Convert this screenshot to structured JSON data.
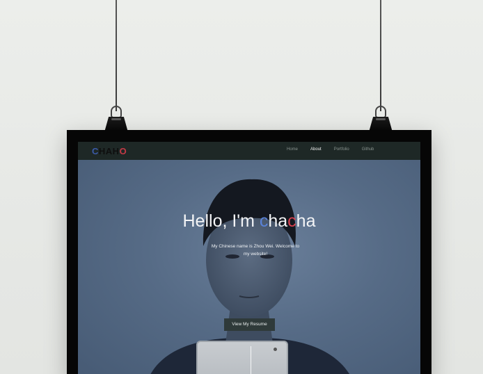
{
  "site": {
    "logo": {
      "part1": "C",
      "part2": "HAH",
      "part3": "O"
    },
    "nav": {
      "items": [
        {
          "label": "Home",
          "active": false
        },
        {
          "label": "About",
          "active": true
        },
        {
          "label": "Portfolio",
          "active": false
        },
        {
          "label": "Github",
          "active": false
        }
      ]
    },
    "hero": {
      "title_prefix": "Hello, I'm ",
      "title_c1": "c",
      "title_mid": "ha",
      "title_c2": "c",
      "title_end": "ha",
      "subtitle": "My Chinese name is Zhou Wei. Welcome to my website!",
      "cta_label": "View My Resume"
    }
  },
  "colors": {
    "accent_blue": "#5a82d8",
    "accent_red": "#d6404f",
    "navbar_bg": "#1e2826",
    "button_bg": "#2f3a3a"
  }
}
